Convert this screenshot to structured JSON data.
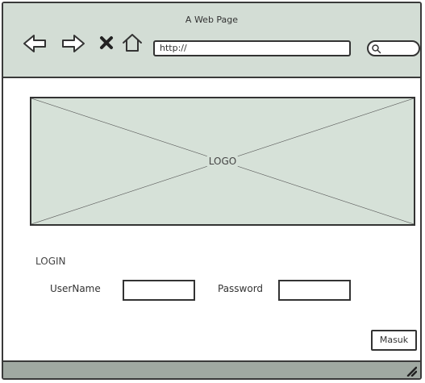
{
  "browser": {
    "title": "A Web Page",
    "url_value": "http://",
    "nav_icons": [
      "back-arrow-icon",
      "forward-arrow-icon",
      "close-icon",
      "home-icon",
      "search-icon",
      "resize-grip-icon"
    ]
  },
  "hero": {
    "logo_label": "LOGO"
  },
  "login": {
    "title": "LOGIN",
    "username_label": "UserName",
    "password_label": "Password",
    "submit_label": "Masuk"
  },
  "colors": {
    "titlebar_bg": "#d3ddd5",
    "placeholder_bg": "#d6e1d8",
    "statusbar_bg": "#a0a9a2",
    "outline": "#333333"
  }
}
